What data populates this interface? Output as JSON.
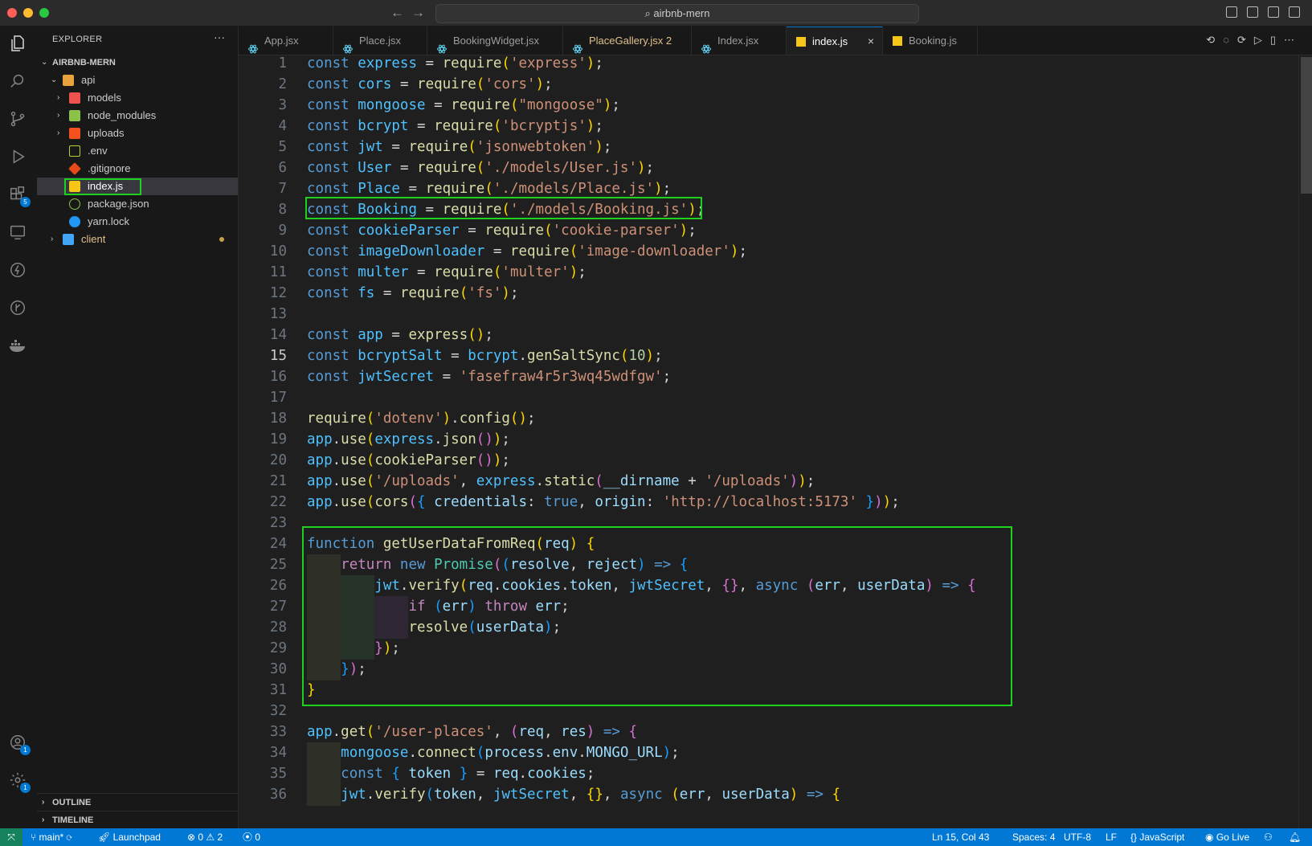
{
  "titlebar": {
    "search_text": "airbnb-mern"
  },
  "explorer": {
    "title": "EXPLORER",
    "more": "···",
    "root": "AIRBNB-MERN",
    "items": [
      {
        "label": "api",
        "icon": "folder-api-icon",
        "color": "#e8a33d"
      },
      {
        "label": "models",
        "icon": "folder-models-icon",
        "color": "#ef5350"
      },
      {
        "label": "node_modules",
        "icon": "folder-node-icon",
        "color": "#8bc34a"
      },
      {
        "label": "uploads",
        "icon": "folder-uploads-icon",
        "color": "#f4511e"
      },
      {
        "label": ".env",
        "icon": "env-icon",
        "color": "#c0ca33"
      },
      {
        "label": ".gitignore",
        "icon": "git-icon",
        "color": "#e64a19"
      },
      {
        "label": "index.js",
        "icon": "js-icon",
        "color": "#f5c518"
      },
      {
        "label": "package.json",
        "icon": "nodejs-icon",
        "color": "#8bc34a"
      },
      {
        "label": "yarn.lock",
        "icon": "yarn-icon",
        "color": "#2196f3"
      },
      {
        "label": "client",
        "icon": "folder-client-icon",
        "color": "#42a5f5"
      }
    ],
    "outline": "OUTLINE",
    "timeline": "TIMELINE"
  },
  "tabs": [
    {
      "label": "App.jsx",
      "color": "#61dafb"
    },
    {
      "label": "Place.jsx",
      "color": "#61dafb"
    },
    {
      "label": "BookingWidget.jsx",
      "color": "#61dafb"
    },
    {
      "label": "PlaceGallery.jsx 2",
      "color": "#61dafb"
    },
    {
      "label": "Index.jsx",
      "color": "#61dafb"
    },
    {
      "label": "index.js",
      "color": "#f5c518"
    },
    {
      "label": "Booking.js",
      "color": "#f5c518"
    }
  ],
  "tab_close": "×",
  "editor": {
    "current_line": 15,
    "lines": [
      "const express = require('express');",
      "const cors = require('cors');",
      "const mongoose = require(\"mongoose\");",
      "const bcrypt = require('bcryptjs');",
      "const jwt = require('jsonwebtoken');",
      "const User = require('./models/User.js');",
      "const Place = require('./models/Place.js');",
      "const Booking = require('./models/Booking.js');",
      "const cookieParser = require('cookie-parser');",
      "const imageDownloader = require('image-downloader');",
      "const multer = require('multer');",
      "const fs = require('fs');",
      "",
      "const app = express();",
      "const bcryptSalt = bcrypt.genSaltSync(10);",
      "const jwtSecret = 'fasefraw4r5r3wq45wdfgw';",
      "",
      "require('dotenv').config();",
      "app.use(express.json());",
      "app.use(cookieParser());",
      "app.use('/uploads', express.static(__dirname + '/uploads'));",
      "app.use(cors({ credentials: true, origin: 'http://localhost:5173' }));",
      "",
      "function getUserDataFromReq(req) {",
      "    return new Promise((resolve, reject) => {",
      "        jwt.verify(req.cookies.token, jwtSecret, {}, async (err, userData) => {",
      "            if (err) throw err;",
      "            resolve(userData);",
      "        });",
      "    });",
      "}",
      "",
      "app.get('/user-places', (req, res) => {",
      "    mongoose.connect(process.env.MONGO_URL);",
      "    const { token } = req.cookies;",
      "    jwt.verify(token, jwtSecret, {}, async (err, userData) => {"
    ]
  },
  "statusbar": {
    "branch": "main*",
    "launchpad": "Launchpad",
    "problems": "⊗ 0 ⚠ 2",
    "ports": "0",
    "position": "Ln 15, Col 43",
    "spaces": "Spaces: 4",
    "encoding": "UTF-8",
    "eol": "LF",
    "language": "JavaScript",
    "golive": "Go Live"
  },
  "badges": {
    "extensions": "5",
    "accounts": "1",
    "settings": "1"
  }
}
